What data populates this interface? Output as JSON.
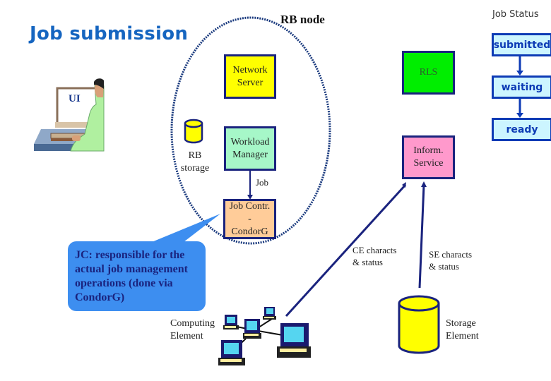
{
  "title": "Job submission",
  "rb_node": {
    "label": "RB node",
    "network_server": [
      "Network",
      "Server"
    ],
    "workload_manager": [
      "Workload",
      "Manager"
    ],
    "job_controller": [
      "Job Contr.",
      "-",
      "CondorG"
    ],
    "rb_storage": [
      "RB",
      "storage"
    ],
    "job_arrow_label": "Job"
  },
  "ui": {
    "label": "UI"
  },
  "services": {
    "rls": "RLS",
    "information_service": [
      "Inform.",
      "Service"
    ]
  },
  "job_status": {
    "title": "Job Status",
    "states": [
      "submitted",
      "waiting",
      "ready"
    ]
  },
  "links": {
    "ce_status": [
      "CE characts",
      "& status"
    ],
    "se_status": [
      "SE characts",
      "& status"
    ]
  },
  "computing_element": [
    "Computing",
    "Element"
  ],
  "storage_element": [
    "Storage",
    "Element"
  ],
  "callout": "JC: responsible for the actual job management operations (done via CondorG)",
  "colors": {
    "title": "#1565c0",
    "border": "#1a237e",
    "network_server": "#ffff00",
    "workload_manager": "#a6f7c8",
    "job_controller": "#ffcc99",
    "rls": "#00ee00",
    "information_service": "#ff99cc",
    "status_fill": "#ccf5ff",
    "callout": "#3d8ef0",
    "storage": "#ffff00"
  }
}
